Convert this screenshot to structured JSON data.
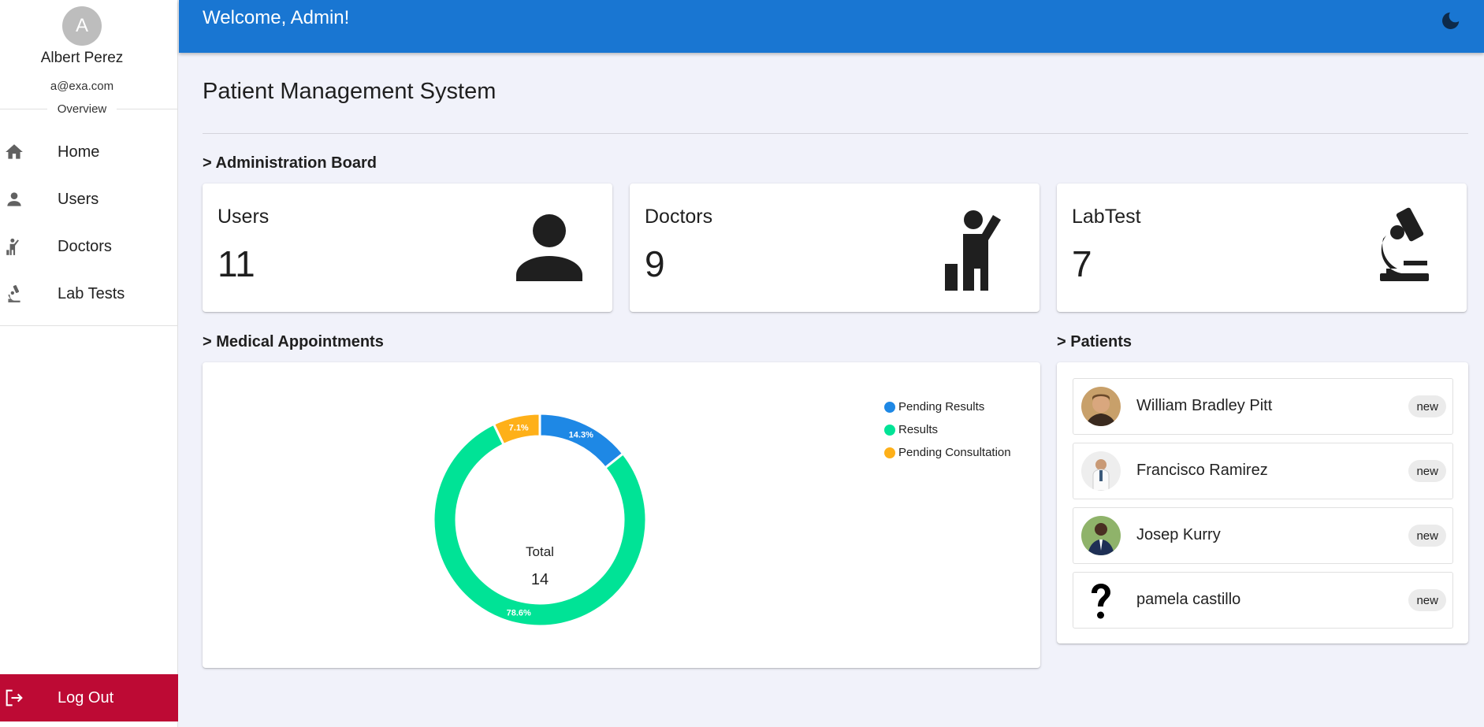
{
  "sidebar": {
    "avatar_letter": "A",
    "user_name": "Albert Perez",
    "user_email": "a@exa.com",
    "section_label": "Overview",
    "items": [
      {
        "label": "Home",
        "icon": "home-icon"
      },
      {
        "label": "Users",
        "icon": "person-icon"
      },
      {
        "label": "Doctors",
        "icon": "doctor-icon"
      },
      {
        "label": "Lab Tests",
        "icon": "microscope-icon"
      }
    ],
    "logout_label": "Log Out",
    "logout_color": "#bd0a34"
  },
  "header": {
    "welcome": "Welcome, Admin!",
    "theme_icon": "moon-icon",
    "color": "#1976d2"
  },
  "page_title": "Patient Management System",
  "admin_board": {
    "heading": "> Administration Board",
    "cards": [
      {
        "title": "Users",
        "value": "11",
        "icon": "person-icon"
      },
      {
        "title": "Doctors",
        "value": "9",
        "icon": "doctor-icon"
      },
      {
        "title": "LabTest",
        "value": "7",
        "icon": "microscope-icon"
      }
    ]
  },
  "appointments": {
    "heading": "> Medical Appointments",
    "center_label": "Total",
    "center_value": "14"
  },
  "chart_data": {
    "type": "pie",
    "categories": [
      "Pending Results",
      "Results",
      "Pending Consultation"
    ],
    "values": [
      2,
      11,
      1
    ],
    "percent_labels": [
      "14.3%",
      "78.6%",
      "7.1%"
    ],
    "colors": [
      "#1e88e5",
      "#00e396",
      "#feb019"
    ],
    "legend_position": "top-right"
  },
  "patients": {
    "heading": "> Patients",
    "items": [
      {
        "name": "William Bradley Pitt",
        "badge": "new"
      },
      {
        "name": "Francisco Ramirez",
        "badge": "new"
      },
      {
        "name": "Josep Kurry",
        "badge": "new"
      },
      {
        "name": "pamela castillo",
        "badge": "new"
      }
    ]
  }
}
